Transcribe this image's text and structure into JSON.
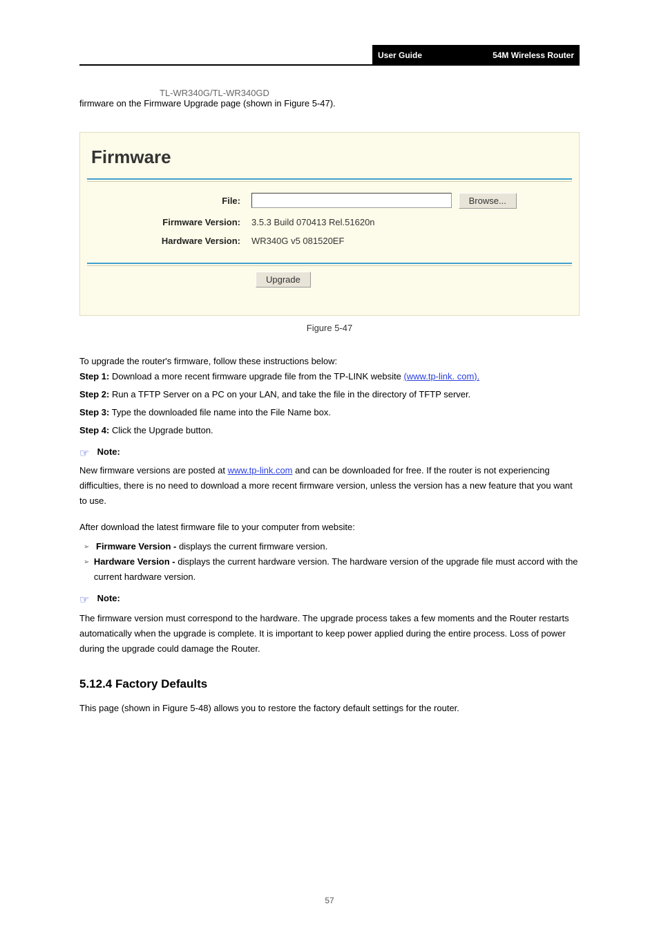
{
  "header": {
    "product": "TL-WR340G/TL-WR340GD",
    "manual": "User Guide",
    "subtitle": "54M Wireless Router"
  },
  "intro": "firmware on the Firmware Upgrade page (shown in Figure 5-47).",
  "panel": {
    "title": "Firmware",
    "file_label": "File:",
    "file_value": "",
    "browse": "Browse...",
    "fw_label": "Firmware Version:",
    "fw_value": "3.5.3 Build 070413 Rel.51620n",
    "hw_label": "Hardware Version:",
    "hw_value": "WR340G v5 081520EF",
    "upgrade": "Upgrade"
  },
  "figure_caption": "Figure 5-47",
  "steps_intro": "To upgrade the router's firmware, follow these instructions below:",
  "steps": [
    {
      "num": "Step 1:",
      "text": "Download a more recent firmware upgrade file from the TP-LINK website"
    },
    {
      "num": "Step 2:",
      "text": "Run a TFTP Server on a PC on your LAN, and take the file in the directory of TFTP server."
    },
    {
      "num": "Step 3:",
      "text": "Type the downloaded file name into the File Name box."
    },
    {
      "num": "Step 4:",
      "text": "Click the Upgrade button."
    }
  ],
  "link_url": "(www.tp-link. com).",
  "note1_label": "Note:",
  "note1_body": "New firmware versions are posted at www.tp-link.com and can be downloaded for free. If the router is not experiencing difficulties, there is no need to download a more recent firmware version, unless the version has a new feature that you want to use.",
  "note_link": "www.tp-link.com",
  "after_download": "After download the latest firmware file to your computer from website:",
  "bullets": [
    {
      "label": "Firmware Version -",
      "rest": " displays the current firmware version."
    },
    {
      "label": "Hardware Version -",
      "rest": " displays the current hardware version. The hardware version of the upgrade file must accord with the current hardware version."
    }
  ],
  "note2_label": "Note:",
  "note2_body": "The firmware version must correspond to the hardware. The upgrade process takes a few moments and the Router restarts automatically when the upgrade is complete. It is important to keep power applied during the entire process. Loss of power during the upgrade could damage the Router.",
  "section": {
    "heading": "5.12.4 Factory Defaults",
    "body_prefix": "This page (shown in ",
    "body_figref": "Figure 5-48",
    "body_suffix": ") allows you to restore the factory default settings for the router."
  },
  "page_number": "57"
}
